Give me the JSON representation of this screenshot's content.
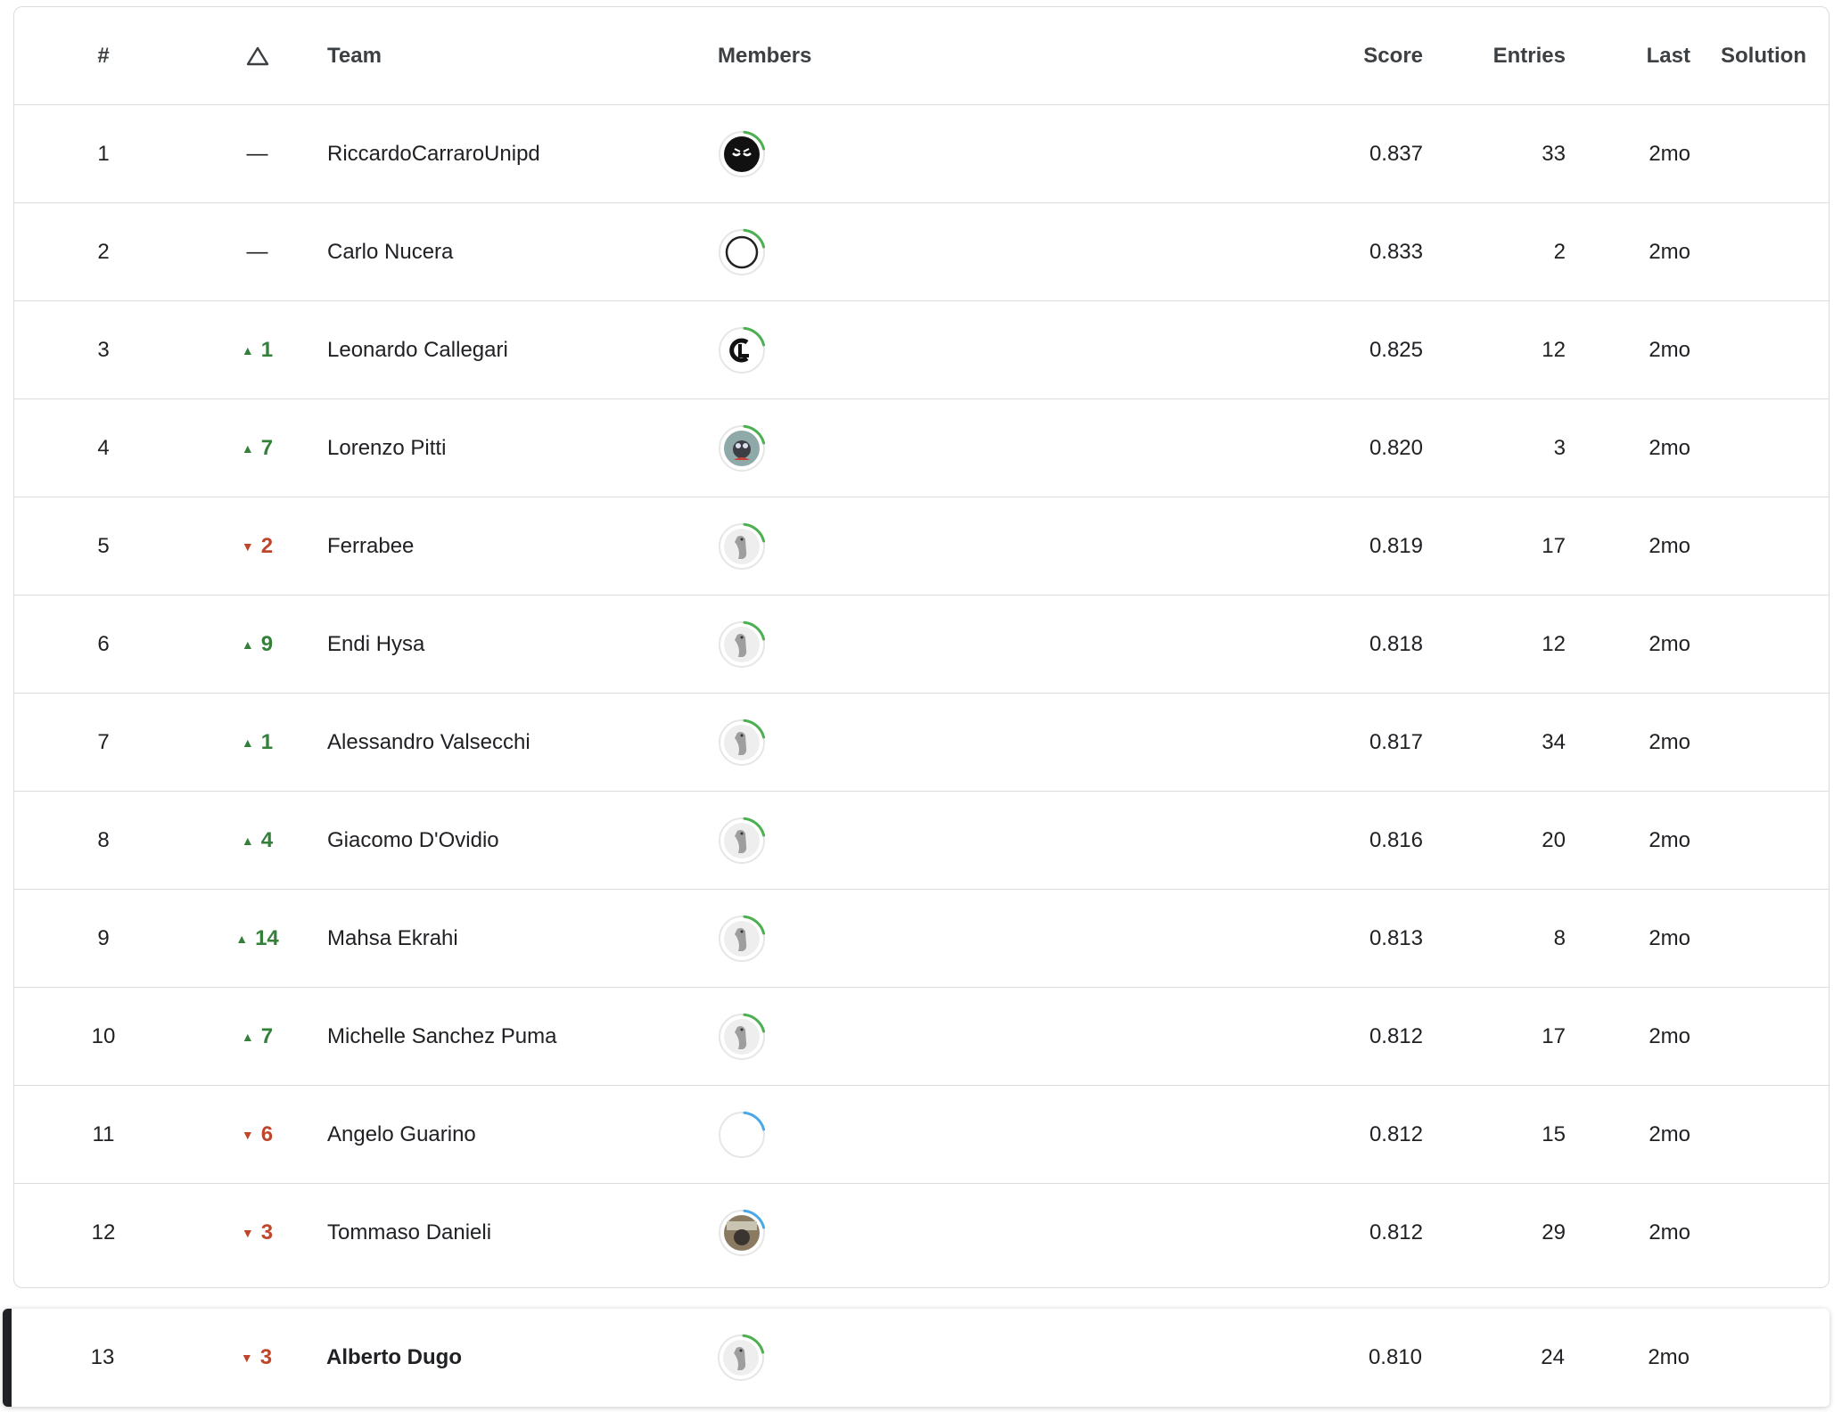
{
  "header": {
    "rank": "#",
    "delta_icon": "triangle-up-outline-icon",
    "team": "Team",
    "members": "Members",
    "score": "Score",
    "entries": "Entries",
    "last": "Last",
    "solution": "Solution"
  },
  "colors": {
    "up": "#34803a",
    "down": "#c0462b",
    "ring_green": "#4caf50",
    "ring_blue": "#4aa8e8"
  },
  "rows": [
    {
      "rank": "1",
      "dir": "none",
      "delta": "—",
      "team": "RiccardoCarraroUnipd",
      "avatar": "black-face",
      "ring": "green",
      "score": "0.837",
      "entries": "33",
      "last": "2mo"
    },
    {
      "rank": "2",
      "dir": "none",
      "delta": "—",
      "team": "Carlo Nucera",
      "avatar": "circle-outline",
      "ring": "green",
      "score": "0.833",
      "entries": "2",
      "last": "2mo"
    },
    {
      "rank": "3",
      "dir": "up",
      "delta": "1",
      "team": "Leonardo Callegari",
      "avatar": "cl-logo",
      "ring": "green",
      "score": "0.825",
      "entries": "12",
      "last": "2mo"
    },
    {
      "rank": "4",
      "dir": "up",
      "delta": "7",
      "team": "Lorenzo Pitti",
      "avatar": "photo",
      "ring": "green",
      "score": "0.820",
      "entries": "3",
      "last": "2mo"
    },
    {
      "rank": "5",
      "dir": "down",
      "delta": "2",
      "team": "Ferrabee",
      "avatar": "default",
      "ring": "green",
      "score": "0.819",
      "entries": "17",
      "last": "2mo"
    },
    {
      "rank": "6",
      "dir": "up",
      "delta": "9",
      "team": "Endi Hysa",
      "avatar": "default",
      "ring": "green",
      "score": "0.818",
      "entries": "12",
      "last": "2mo"
    },
    {
      "rank": "7",
      "dir": "up",
      "delta": "1",
      "team": "Alessandro Valsecchi",
      "avatar": "default",
      "ring": "green",
      "score": "0.817",
      "entries": "34",
      "last": "2mo"
    },
    {
      "rank": "8",
      "dir": "up",
      "delta": "4",
      "team": "Giacomo D'Ovidio",
      "avatar": "default",
      "ring": "green",
      "score": "0.816",
      "entries": "20",
      "last": "2mo"
    },
    {
      "rank": "9",
      "dir": "up",
      "delta": "14",
      "team": "Mahsa Ekrahi",
      "avatar": "default",
      "ring": "green",
      "score": "0.813",
      "entries": "8",
      "last": "2mo"
    },
    {
      "rank": "10",
      "dir": "up",
      "delta": "7",
      "team": "Michelle Sanchez Puma",
      "avatar": "default",
      "ring": "green",
      "score": "0.812",
      "entries": "17",
      "last": "2mo"
    },
    {
      "rank": "11",
      "dir": "down",
      "delta": "6",
      "team": "Angelo Guarino",
      "avatar": "empty",
      "ring": "blue",
      "score": "0.812",
      "entries": "15",
      "last": "2mo"
    },
    {
      "rank": "12",
      "dir": "down",
      "delta": "3",
      "team": "Tommaso Danieli",
      "avatar": "photo2",
      "ring": "blue",
      "score": "0.812",
      "entries": "29",
      "last": "2mo"
    }
  ],
  "current": {
    "rank": "13",
    "dir": "down",
    "delta": "3",
    "team": "Alberto Dugo",
    "avatar": "default",
    "ring": "green",
    "score": "0.810",
    "entries": "24",
    "last": "2mo"
  }
}
